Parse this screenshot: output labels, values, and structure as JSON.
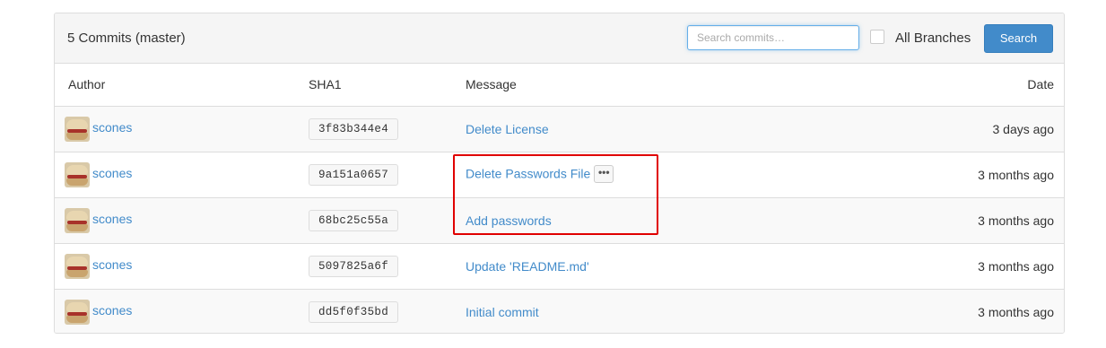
{
  "header": {
    "title": "5 Commits (master)",
    "search_placeholder": "Search commits…",
    "search_value": "",
    "all_branches_label": "All Branches",
    "all_branches_checked": false,
    "search_button": "Search"
  },
  "columns": {
    "author": "Author",
    "sha": "SHA1",
    "message": "Message",
    "date": "Date"
  },
  "commits": [
    {
      "author": "scones",
      "sha": "3f83b344e4",
      "message": "Delete License",
      "date": "3 days ago",
      "has_ellipsis": false
    },
    {
      "author": "scones",
      "sha": "9a151a0657",
      "message": "Delete Passwords File",
      "date": "3 months ago",
      "has_ellipsis": true,
      "ellipsis": "•••"
    },
    {
      "author": "scones",
      "sha": "68bc25c55a",
      "message": "Add passwords",
      "date": "3 months ago",
      "has_ellipsis": false
    },
    {
      "author": "scones",
      "sha": "5097825a6f",
      "message": "Update 'README.md'",
      "date": "3 months ago",
      "has_ellipsis": false
    },
    {
      "author": "scones",
      "sha": "dd5f0f35bd",
      "message": "Initial commit",
      "date": "3 months ago",
      "has_ellipsis": false
    }
  ],
  "icons": {
    "avatar": "scones-avatar-icon",
    "ellipsis": "ellipsis-icon"
  },
  "colors": {
    "link": "#428bca",
    "button": "#428bca",
    "highlight": "#e00000",
    "header_bg": "#f5f5f5",
    "row_stripe": "#f9f9f9"
  }
}
